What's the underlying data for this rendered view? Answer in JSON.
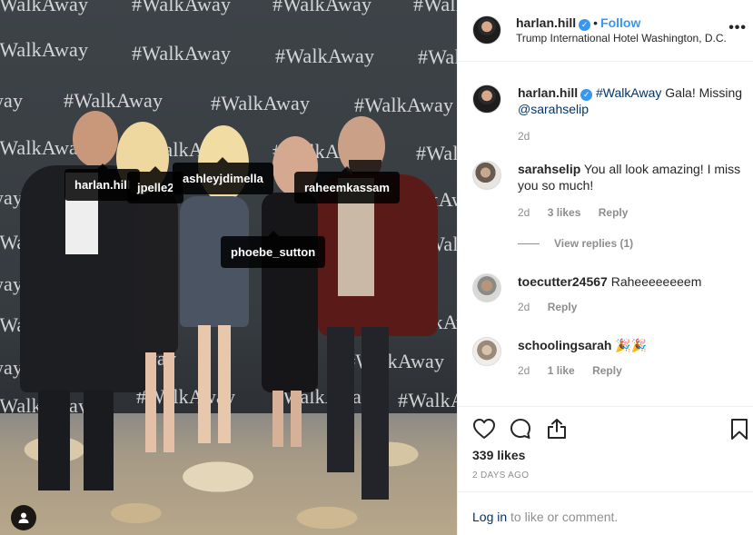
{
  "photo": {
    "backdrop_text": "#WalkAway",
    "tags": [
      "harlan.hill",
      "jpelle2",
      "ashleyjdimella",
      "raheemkassam",
      "phoebe_sutton"
    ]
  },
  "header": {
    "username": "harlan.hill",
    "separator": "•",
    "follow_label": "Follow",
    "location": "Trump International Hotel Washington, D.C."
  },
  "comments": [
    {
      "username": "harlan.hill",
      "text_parts": [
        "#WalkAway",
        " Gala! Missing ",
        "@sarahselip"
      ],
      "age": "2d"
    },
    {
      "username": "sarahselip",
      "text": "You all look amazing! I miss you so much!",
      "age": "2d",
      "likes": "3 likes",
      "reply": "Reply",
      "view_replies": "View replies (1)"
    },
    {
      "username": "toecutter24567",
      "text": "Raheeeeeeeem",
      "age": "2d",
      "reply": "Reply"
    },
    {
      "username": "schoolingsarah",
      "text": "🎉🎉",
      "age": "2d",
      "likes": "1 like",
      "reply": "Reply"
    }
  ],
  "actions": {
    "likes": "339 likes",
    "posted": "2 DAYS AGO",
    "login_link": "Log in",
    "login_suffix": " to like or comment."
  },
  "colors": {
    "accent": "#3897f0",
    "link": "#003569",
    "muted": "#8e8e8e",
    "border": "#efefef"
  }
}
